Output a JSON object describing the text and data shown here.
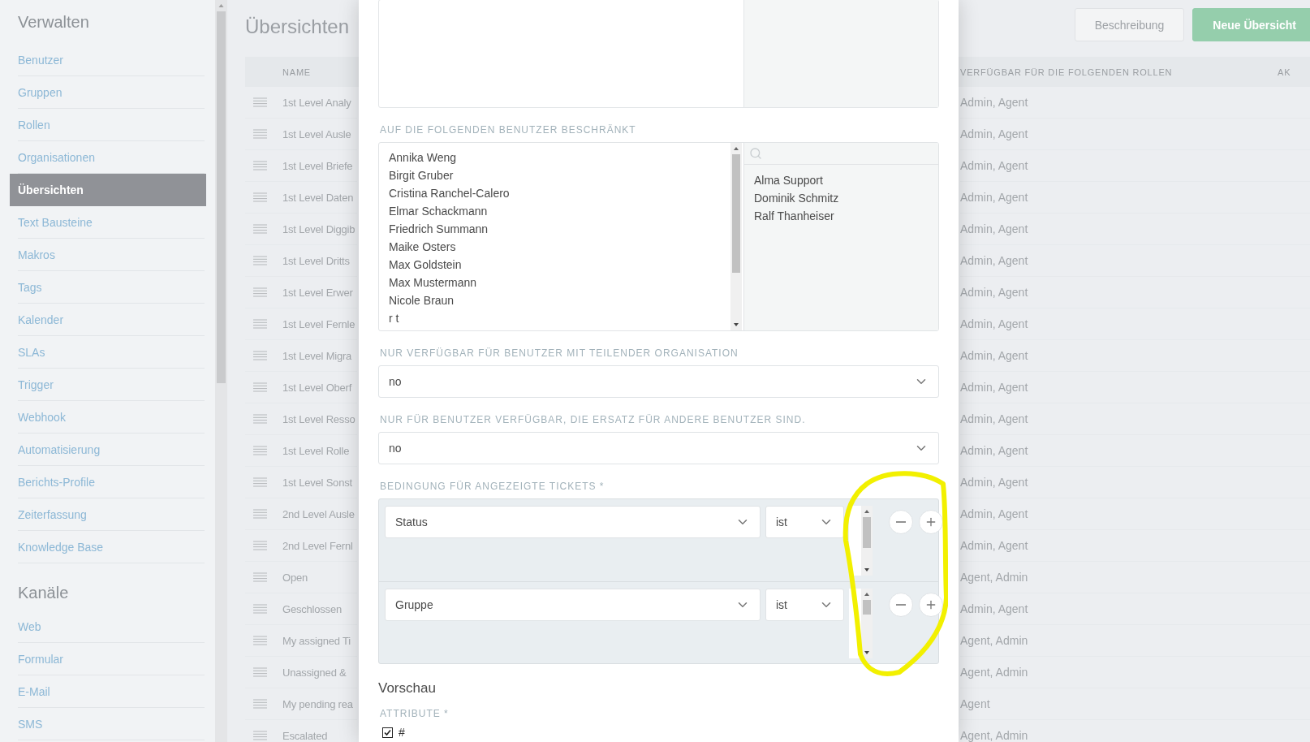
{
  "sidebar": {
    "sections": [
      {
        "title": "Verwalten",
        "items": [
          {
            "label": "Benutzer",
            "selected": false
          },
          {
            "label": "Gruppen",
            "selected": false
          },
          {
            "label": "Rollen",
            "selected": false
          },
          {
            "label": "Organisationen",
            "selected": false
          },
          {
            "label": "Übersichten",
            "selected": true
          },
          {
            "label": "Text Bausteine",
            "selected": false
          },
          {
            "label": "Makros",
            "selected": false
          },
          {
            "label": "Tags",
            "selected": false
          },
          {
            "label": "Kalender",
            "selected": false
          },
          {
            "label": "SLAs",
            "selected": false
          },
          {
            "label": "Trigger",
            "selected": false
          },
          {
            "label": "Webhook",
            "selected": false
          },
          {
            "label": "Automatisierung",
            "selected": false
          },
          {
            "label": "Berichts-Profile",
            "selected": false
          },
          {
            "label": "Zeiterfassung",
            "selected": false
          },
          {
            "label": "Knowledge Base",
            "selected": false
          }
        ]
      },
      {
        "title": "Kanäle",
        "items": [
          {
            "label": "Web",
            "selected": false
          },
          {
            "label": "Formular",
            "selected": false
          },
          {
            "label": "E-Mail",
            "selected": false
          },
          {
            "label": "SMS",
            "selected": false
          }
        ]
      }
    ]
  },
  "page": {
    "title": "Übersichten",
    "buttons": [
      {
        "label": "Beschreibung",
        "kind": "secondary"
      },
      {
        "label": "Neue Übersicht",
        "kind": "primary"
      }
    ]
  },
  "table": {
    "columns": [
      "NAME",
      "VERFÜGBAR FÜR DIE FOLGENDEN ROLLEN",
      "AK"
    ],
    "rows": [
      {
        "name": "1st Level Analy",
        "roles": "Admin, Agent"
      },
      {
        "name": "1st Level Ausle",
        "roles": "Admin, Agent"
      },
      {
        "name": "1st Level Briefe",
        "roles": "Admin, Agent"
      },
      {
        "name": "1st Level Daten",
        "roles": "Admin, Agent"
      },
      {
        "name": "1st Level Diggib",
        "roles": "Admin, Agent"
      },
      {
        "name": "1st Level Dritts",
        "roles": "Admin, Agent"
      },
      {
        "name": "1st Level Erwer",
        "roles": "Admin, Agent"
      },
      {
        "name": "1st Level Fernle",
        "roles": "Admin, Agent"
      },
      {
        "name": "1st Level Migra",
        "roles": "Admin, Agent"
      },
      {
        "name": "1st Level Oberf",
        "roles": "Admin, Agent"
      },
      {
        "name": "1st Level Resso",
        "roles": "Admin, Agent"
      },
      {
        "name": "1st Level Rolle",
        "roles": "Admin, Agent"
      },
      {
        "name": "1st Level Sonst",
        "roles": "Admin, Agent"
      },
      {
        "name": "2nd Level Ausle",
        "roles": "Admin, Agent"
      },
      {
        "name": "2nd Level Fernl",
        "roles": "Admin, Agent"
      },
      {
        "name": "Open",
        "roles": "Agent, Admin"
      },
      {
        "name": "Geschlossen",
        "roles": "Admin, Agent"
      },
      {
        "name": "My assigned Ti",
        "roles": "Agent, Admin"
      },
      {
        "name": "Unassigned &",
        "roles": "Agent, Admin"
      },
      {
        "name": "My pending rea",
        "roles": "Agent"
      },
      {
        "name": "Escalated",
        "roles": "Agent, Admin"
      }
    ]
  },
  "modal": {
    "user_restriction": {
      "label": "AUF DIE FOLGENDEN BENUTZER BESCHRÄNKT",
      "available": [
        "Annika Weng",
        "Birgit Gruber",
        "Cristina Ranchel-Calero",
        "Elmar Schackmann",
        "Friedrich Summann",
        "Maike Osters",
        "Max Goldstein",
        "Max Mustermann",
        "Nicole Braun",
        "r t"
      ],
      "chosen": [
        "Alma Support",
        "Dominik Schmitz",
        "Ralf Thanheiser"
      ]
    },
    "selects": [
      {
        "label": "NUR VERFÜGBAR FÜR BENUTZER MIT TEILENDER ORGANISATION",
        "value": "no"
      },
      {
        "label": "NUR FÜR BENUTZER VERFÜGBAR, DIE ERSATZ FÜR ANDERE BENUTZER SIND.",
        "value": "no"
      }
    ],
    "conditions": {
      "label": "BEDINGUNG FÜR ANGEZEIGTE TICKETS *",
      "rows": [
        {
          "attribute": "Status",
          "operator": "ist"
        },
        {
          "attribute": "Gruppe",
          "operator": "ist"
        }
      ]
    },
    "preview": {
      "title": "Vorschau",
      "attribute_label": "ATTRIBUTE *",
      "attributes": [
        {
          "label": "#",
          "checked": true
        }
      ]
    }
  }
}
